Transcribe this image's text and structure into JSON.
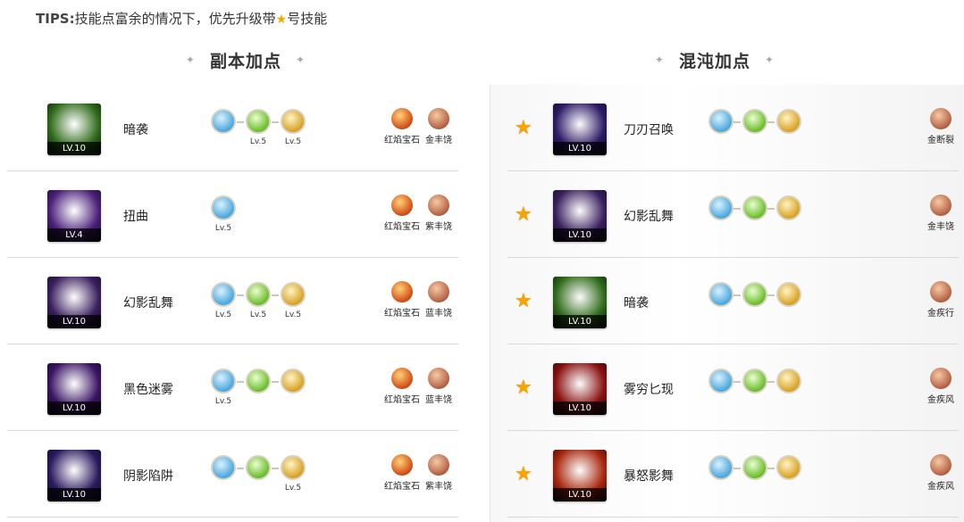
{
  "tips": {
    "prefix": "TIPS:",
    "text_before": "技能点富余的情况下，优先升级带",
    "star_glyph": "★",
    "text_after": "号技能"
  },
  "titles": {
    "left": "副本加点",
    "right": "混沌加点",
    "deco": "✦"
  },
  "left_rows": [
    {
      "name": "暗袭",
      "level": "LV.10",
      "color": "#2f6b1a",
      "runes": [
        {
          "c": "blue",
          "lv": ""
        },
        {
          "c": "green",
          "lv": "Lv.5"
        },
        {
          "c": "gold",
          "lv": "Lv.5"
        }
      ],
      "gems": [
        {
          "c": "red",
          "label": "红焰宝石"
        },
        {
          "c": "brown",
          "label": "金丰饶"
        }
      ]
    },
    {
      "name": "扭曲",
      "level": "LV.4",
      "color": "#4b1f7a",
      "runes": [
        {
          "c": "blue",
          "lv": "Lv.5"
        }
      ],
      "gems": [
        {
          "c": "red",
          "label": "红焰宝石"
        },
        {
          "c": "brown",
          "label": "紫丰饶"
        }
      ]
    },
    {
      "name": "幻影乱舞",
      "level": "LV.10",
      "color": "#3a1f5e",
      "runes": [
        {
          "c": "blue",
          "lv": "Lv.5"
        },
        {
          "c": "green",
          "lv": "Lv.5"
        },
        {
          "c": "gold",
          "lv": "Lv.5"
        }
      ],
      "gems": [
        {
          "c": "red",
          "label": "红焰宝石"
        },
        {
          "c": "brown",
          "label": "蓝丰饶"
        }
      ]
    },
    {
      "name": "黑色迷雾",
      "level": "LV.10",
      "color": "#3b1464",
      "runes": [
        {
          "c": "blue",
          "lv": "Lv.5"
        },
        {
          "c": "green",
          "lv": ""
        },
        {
          "c": "gold",
          "lv": ""
        }
      ],
      "gems": [
        {
          "c": "red",
          "label": "红焰宝石"
        },
        {
          "c": "brown",
          "label": "蓝丰饶"
        }
      ]
    },
    {
      "name": "阴影陷阱",
      "level": "LV.10",
      "color": "#2a1a5e",
      "runes": [
        {
          "c": "blue",
          "lv": ""
        },
        {
          "c": "green",
          "lv": ""
        },
        {
          "c": "gold",
          "lv": "Lv.5"
        }
      ],
      "gems": [
        {
          "c": "red",
          "label": "红焰宝石"
        },
        {
          "c": "brown",
          "label": "紫丰饶"
        }
      ]
    }
  ],
  "right_rows": [
    {
      "name": "刀刃召唤",
      "level": "LV.10",
      "color": "#2d1a66",
      "runes": [
        {
          "c": "blue",
          "lv": ""
        },
        {
          "c": "green",
          "lv": ""
        },
        {
          "c": "gold",
          "lv": ""
        }
      ],
      "gems": [
        {
          "c": "brown",
          "label": "金断裂"
        }
      ]
    },
    {
      "name": "幻影乱舞",
      "level": "LV.10",
      "color": "#3a1f5e",
      "runes": [
        {
          "c": "blue",
          "lv": ""
        },
        {
          "c": "green",
          "lv": ""
        },
        {
          "c": "gold",
          "lv": ""
        }
      ],
      "gems": [
        {
          "c": "brown",
          "label": "金丰饶"
        }
      ]
    },
    {
      "name": "暗袭",
      "level": "LV.10",
      "color": "#2f6b1a",
      "runes": [
        {
          "c": "blue",
          "lv": ""
        },
        {
          "c": "green",
          "lv": ""
        },
        {
          "c": "gold",
          "lv": ""
        }
      ],
      "gems": [
        {
          "c": "brown",
          "label": "金疾行"
        }
      ]
    },
    {
      "name": "雾穷匕现",
      "level": "LV.10",
      "color": "#8a1010",
      "runes": [
        {
          "c": "blue",
          "lv": ""
        },
        {
          "c": "green",
          "lv": ""
        },
        {
          "c": "gold",
          "lv": ""
        }
      ],
      "gems": [
        {
          "c": "brown",
          "label": "金疾风"
        }
      ]
    },
    {
      "name": "暴怒影舞",
      "level": "LV.10",
      "color": "#a8260c",
      "runes": [
        {
          "c": "blue",
          "lv": ""
        },
        {
          "c": "green",
          "lv": ""
        },
        {
          "c": "gold",
          "lv": ""
        }
      ],
      "gems": [
        {
          "c": "brown",
          "label": "金疾风"
        }
      ]
    }
  ]
}
